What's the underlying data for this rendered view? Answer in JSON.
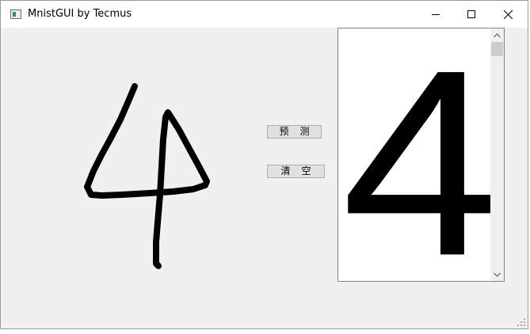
{
  "window": {
    "title": "MnistGUI by Tecmus"
  },
  "buttons": {
    "predict_label": "预测",
    "clear_label": "清空"
  },
  "result": {
    "predicted_digit": "4"
  },
  "icons": {
    "app": "app-icon",
    "minimize": "minimize-icon",
    "maximize": "maximize-icon",
    "close": "close-icon",
    "scroll_up": "chevron-up-icon",
    "scroll_down": "chevron-down-icon",
    "size_grip": "resize-grip-icon"
  }
}
